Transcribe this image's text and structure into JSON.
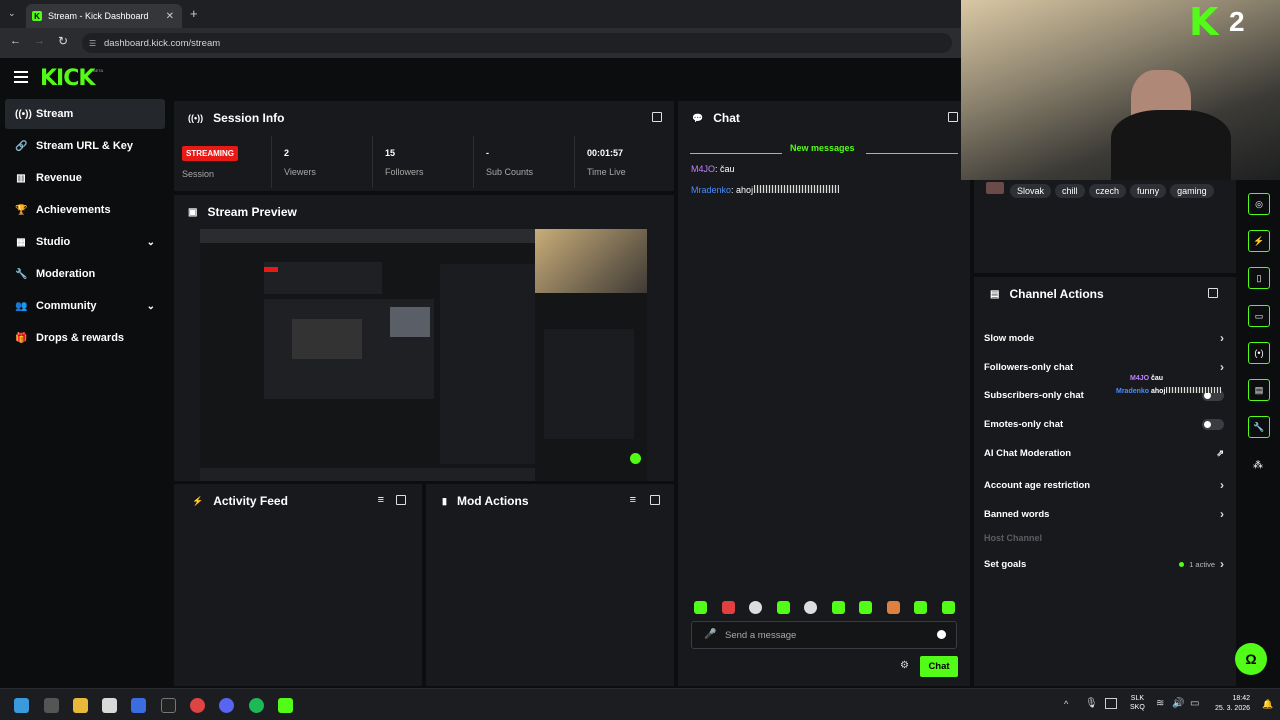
{
  "browser": {
    "tab_title": "Stream - Kick Dashboard",
    "url": "dashboard.kick.com/stream"
  },
  "app": {
    "logo": "KICK",
    "logo_tag": "BETA"
  },
  "sidebar": {
    "items": [
      {
        "label": "Stream",
        "icon": "broadcast-icon",
        "active": true
      },
      {
        "label": "Stream URL & Key",
        "icon": "link-icon"
      },
      {
        "label": "Revenue",
        "icon": "chart-icon"
      },
      {
        "label": "Achievements",
        "icon": "trophy-icon"
      },
      {
        "label": "Studio",
        "icon": "grid-icon",
        "expandable": true
      },
      {
        "label": "Moderation",
        "icon": "wrench-icon"
      },
      {
        "label": "Community",
        "icon": "people-icon",
        "expandable": true
      },
      {
        "label": "Drops & rewards",
        "icon": "gift-icon"
      }
    ]
  },
  "session": {
    "title": "Session Info",
    "status_badge": "STREAMING",
    "status_label": "Session",
    "stats": [
      {
        "value": "2",
        "label": "Viewers"
      },
      {
        "value": "15",
        "label": "Followers"
      },
      {
        "value": "-",
        "label": "Sub Counts"
      },
      {
        "value": "00:01:57",
        "label": "Time Live"
      }
    ]
  },
  "preview": {
    "title": "Stream Preview"
  },
  "activity": {
    "title": "Activity Feed"
  },
  "mod_actions": {
    "title": "Mod Actions"
  },
  "chat": {
    "title": "Chat",
    "new_messages": "New messages",
    "messages": [
      {
        "user": "M4JO",
        "text": "čau",
        "color": "#c080ff"
      },
      {
        "user": "Mradenko",
        "text": "ahoj",
        "color": "#4a8cff"
      }
    ],
    "input_placeholder": "Send a message",
    "send_label": "Chat"
  },
  "tags": [
    "Slovak",
    "chill",
    "czech",
    "funny",
    "gaming"
  ],
  "overlay": {
    "badge_text": "2"
  },
  "channel_actions": {
    "title": "Channel Actions",
    "items": [
      {
        "label": "Slow mode",
        "control": "chevron"
      },
      {
        "label": "Followers-only chat",
        "control": "chevron"
      },
      {
        "label": "Subscribers-only chat",
        "control": "toggle"
      },
      {
        "label": "Emotes-only chat",
        "control": "toggle"
      },
      {
        "label": "AI Chat Moderation",
        "control": "external"
      },
      {
        "label": "Account age restriction",
        "control": "chevron"
      },
      {
        "label": "Banned words",
        "control": "chevron"
      },
      {
        "label": "Host Channel",
        "control": "none",
        "disabled": true
      },
      {
        "label": "Set goals",
        "control": "chevron",
        "status": "1 active"
      }
    ],
    "popup_chat": [
      {
        "user": "M4JO",
        "text": "čau"
      },
      {
        "user": "Mradenko",
        "text": "ahoj"
      }
    ]
  },
  "taskbar": {
    "lang": "SLK",
    "lang2": "SKQ",
    "time": "18:42",
    "date": "25. 3. 2026"
  },
  "colors": {
    "accent": "#53fc18",
    "live": "#e91916",
    "panel": "#18191c"
  }
}
